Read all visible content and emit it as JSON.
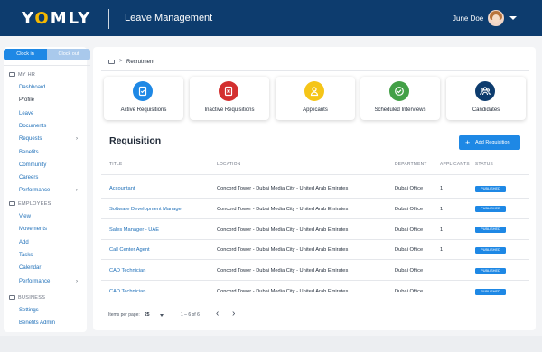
{
  "header": {
    "logo_prefix": "Y",
    "logo_o": "O",
    "logo_suffix": "MLY",
    "app_title": "Leave Management",
    "user_name": "June Doe",
    "bg_color": "#0d3c6e"
  },
  "sidebar": {
    "clock_in": "Clock in",
    "clock_out": "Clock out",
    "sections": [
      {
        "title": "MY HR",
        "items": [
          {
            "label": "Dashboard",
            "has_arrow": false
          },
          {
            "label": "Profile",
            "has_arrow": false,
            "active": true
          },
          {
            "label": "Leave",
            "has_arrow": false
          },
          {
            "label": "Documents",
            "has_arrow": false
          },
          {
            "label": "Requests",
            "has_arrow": true
          },
          {
            "label": "Benefits",
            "has_arrow": false
          },
          {
            "label": "Community",
            "has_arrow": false
          },
          {
            "label": "Careers",
            "has_arrow": false
          },
          {
            "label": "Performance",
            "has_arrow": true
          }
        ]
      },
      {
        "title": "EMPLOYEES",
        "items": [
          {
            "label": "View",
            "has_arrow": false
          },
          {
            "label": "Movements",
            "has_arrow": false
          },
          {
            "label": "Add",
            "has_arrow": false
          },
          {
            "label": "Tasks",
            "has_arrow": false
          },
          {
            "label": "Calendar",
            "has_arrow": false
          },
          {
            "label": "Performance",
            "has_arrow": true
          }
        ]
      },
      {
        "title": "BUSINESS",
        "items": [
          {
            "label": "Settings",
            "has_arrow": false
          },
          {
            "label": "Benefits Admin",
            "has_arrow": false
          }
        ]
      }
    ],
    "arrow_glyph": "›"
  },
  "breadcrumb": {
    "separator": ">",
    "current": "Recrutment"
  },
  "summary_cards": [
    {
      "label": "Active Requisitions",
      "color": "#1e88e5",
      "icon": "document-check-icon"
    },
    {
      "label": "Inactive Requisitions",
      "color": "#d32f2f",
      "icon": "document-x-icon"
    },
    {
      "label": "Applicants",
      "color": "#f5c518",
      "icon": "person-icon"
    },
    {
      "label": "Scheduled Interviews",
      "color": "#43a047",
      "icon": "check-circle-icon"
    },
    {
      "label": "Candidates",
      "color": "#0d3c6e",
      "icon": "group-icon"
    }
  ],
  "requisition": {
    "title": "Requisition",
    "add_button": "Add Requisition",
    "add_plus": "+",
    "columns": {
      "title": "TITLE",
      "location": "LOCATION",
      "department": "DEPARTMENT",
      "applicants": "APPLICANTS",
      "status": "STATUS"
    },
    "rows": [
      {
        "title": "Accountant",
        "location": "Concord Tower - Dubai Media City - United Arab Emirates",
        "department": "Dubai Office",
        "applicants": "1",
        "status": "PUBLISHED"
      },
      {
        "title": "Software Development Manager",
        "location": "Concord Tower - Dubai Media City - United Arab Emirates",
        "department": "Dubai Office",
        "applicants": "1",
        "status": "PUBLISHED"
      },
      {
        "title": "Sales Manager - UAE",
        "location": "Concord Tower - Dubai Media City - United Arab Emirates",
        "department": "Dubai Office",
        "applicants": "1",
        "status": "PUBLISHED"
      },
      {
        "title": "Call Center Agent",
        "location": "Concord Tower - Dubai Media City - United Arab Emirates",
        "department": "Dubai Office",
        "applicants": "1",
        "status": "PUBLISHED"
      },
      {
        "title": "CAD Technician",
        "location": "Concord Tower - Dubai Media City - United Arab Emirates",
        "department": "Dubai Office",
        "applicants": "",
        "status": "PUBLISHED"
      },
      {
        "title": "CAD Technician",
        "location": "Concord Tower - Dubai Media City - United Arab Emirates",
        "department": "Dubai Office",
        "applicants": "",
        "status": "PUBLISHED"
      }
    ],
    "status_color": "#1e88e5"
  },
  "pagination": {
    "items_per_page_label": "Items per page:",
    "items_per_page": "25",
    "range": "1 – 6 of 6",
    "prev": "‹",
    "next": "›"
  }
}
